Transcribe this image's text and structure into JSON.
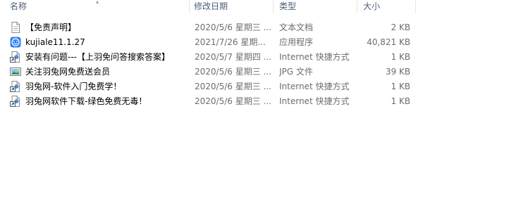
{
  "columns": {
    "name": "名称",
    "date": "修改日期",
    "type": "类型",
    "size": "大小"
  },
  "files": [
    {
      "name": "【免责声明】",
      "date": "2020/5/6 星期三 ...",
      "type": "文本文档",
      "size": "2 KB",
      "icon": "text-file-icon"
    },
    {
      "name": "kujiale11.1.27",
      "date": "2021/7/26 星期...",
      "type": "应用程序",
      "size": "40,821 KB",
      "icon": "app-icon"
    },
    {
      "name": "安装有问题---【上羽免问答搜索答案】",
      "date": "2020/5/7 星期四 ...",
      "type": "Internet 快捷方式",
      "size": "1 KB",
      "icon": "shortcut-icon"
    },
    {
      "name": "关注羽兔网免费送会员",
      "date": "2020/5/6 星期三 ...",
      "type": "JPG 文件",
      "size": "39 KB",
      "icon": "image-file-icon"
    },
    {
      "name": "羽兔网-软件入门免费学！",
      "date": "2020/5/6 星期三 ...",
      "type": "Internet 快捷方式",
      "size": "1 KB",
      "icon": "shortcut-icon"
    },
    {
      "name": "羽兔网软件下载-绿色免费无毒！",
      "date": "2020/5/6 星期三 ...",
      "type": "Internet 快捷方式",
      "size": "1 KB",
      "icon": "shortcut-icon"
    }
  ]
}
